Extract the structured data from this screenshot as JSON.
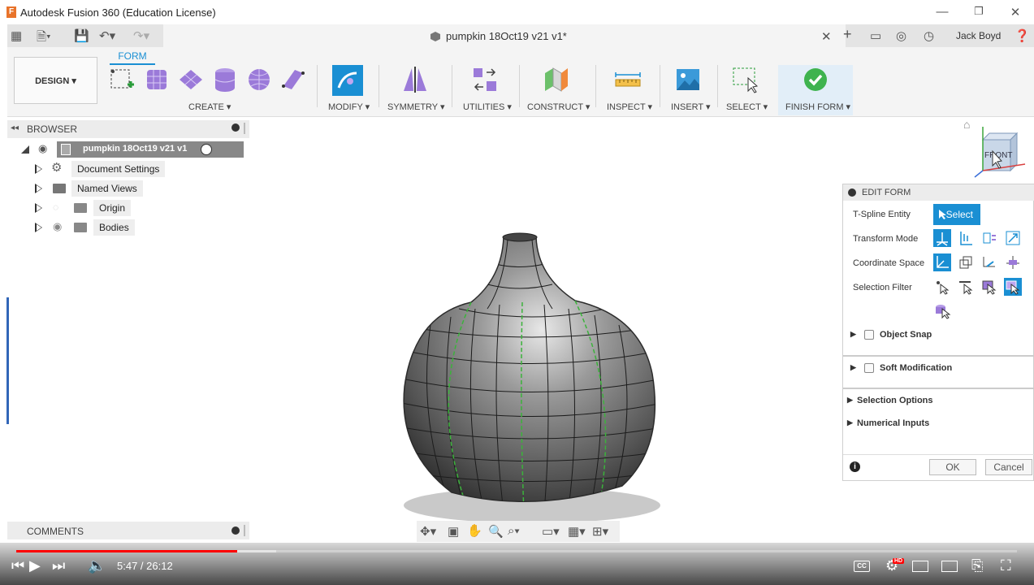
{
  "window": {
    "title": "Autodesk Fusion 360 (Education License)",
    "app_icon": "F"
  },
  "doc_tab": {
    "title": "pumpkin 18Oct19 v21 v1*",
    "user": "Jack Boyd"
  },
  "ribbon": {
    "active_tab": "FORM",
    "workspace": "DESIGN",
    "groups": {
      "create": "CREATE",
      "modify": "MODIFY",
      "symmetry": "SYMMETRY",
      "utilities": "UTILITIES",
      "construct": "CONSTRUCT",
      "inspect": "INSPECT",
      "insert": "INSERT",
      "select": "SELECT",
      "finish": "FINISH FORM"
    }
  },
  "browser": {
    "title": "BROWSER",
    "root": "pumpkin 18Oct19 v21 v1",
    "items": [
      "Document Settings",
      "Named Views",
      "Origin",
      "Bodies"
    ]
  },
  "viewcube": {
    "face": "FRONT"
  },
  "edit_form": {
    "title": "EDIT FORM",
    "rows": {
      "tspline": "T-Spline Entity",
      "transform": "Transform Mode",
      "coord": "Coordinate Space",
      "filter": "Selection Filter"
    },
    "select_label": "Select",
    "sections": [
      "Object Snap",
      "Soft Modification",
      "Selection Options",
      "Numerical Inputs"
    ],
    "ok": "OK",
    "cancel": "Cancel",
    "info": "i"
  },
  "comments": {
    "title": "COMMENTS"
  },
  "video": {
    "current": "5:47",
    "duration": "26:12",
    "progress": 0.221,
    "buffered": 0.26,
    "cc": "CC",
    "hd": "HD"
  }
}
